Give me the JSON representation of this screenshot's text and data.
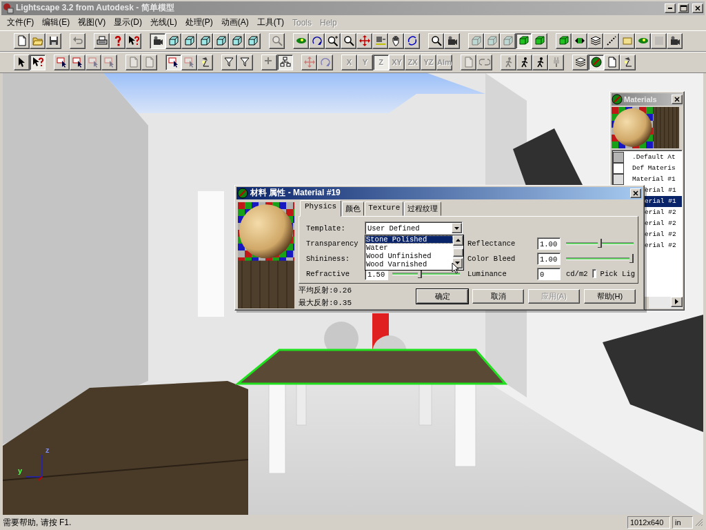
{
  "window": {
    "title": "Lightscape 3.2 from Autodesk - 简单模型"
  },
  "menu": [
    {
      "label": "文件(F)",
      "disabled": false
    },
    {
      "label": "编辑(E)",
      "disabled": false
    },
    {
      "label": "视图(V)",
      "disabled": false
    },
    {
      "label": "显示(D)",
      "disabled": false
    },
    {
      "label": "光线(L)",
      "disabled": false
    },
    {
      "label": "处理(P)",
      "disabled": false
    },
    {
      "label": "动画(A)",
      "disabled": false
    },
    {
      "label": "工具(T)",
      "disabled": false
    },
    {
      "label": "Tools",
      "disabled": true
    },
    {
      "label": "Help",
      "disabled": true
    }
  ],
  "toolbars": [
    [
      [
        {
          "pressed": false,
          "disabled": false
        },
        {
          "pressed": false,
          "disabled": false
        },
        {
          "pressed": false,
          "disabled": false
        }
      ],
      [
        {
          "pressed": false,
          "disabled": true
        }
      ],
      [
        {
          "pressed": false,
          "disabled": false
        },
        {
          "pressed": false,
          "disabled": false
        },
        {
          "pressed": false,
          "disabled": false
        }
      ],
      [
        {
          "pressed": true,
          "disabled": false
        },
        {
          "pressed": false,
          "disabled": false
        },
        {
          "pressed": false,
          "disabled": false
        },
        {
          "pressed": false,
          "disabled": false
        },
        {
          "pressed": false,
          "disabled": false
        },
        {
          "pressed": false,
          "disabled": false
        },
        {
          "pressed": false,
          "disabled": false
        }
      ],
      [
        {
          "pressed": false,
          "disabled": true
        }
      ],
      [
        {
          "pressed": false,
          "disabled": false
        },
        {
          "pressed": false,
          "disabled": false
        },
        {
          "pressed": false,
          "disabled": false
        },
        {
          "pressed": false,
          "disabled": false
        },
        {
          "pressed": false,
          "disabled": false
        },
        {
          "pressed": false,
          "disabled": false
        },
        {
          "pressed": false,
          "disabled": false
        },
        {
          "pressed": false,
          "disabled": false
        }
      ],
      [
        {
          "pressed": false,
          "disabled": false
        },
        {
          "pressed": false,
          "disabled": false
        }
      ],
      [
        {
          "pressed": false,
          "disabled": true
        },
        {
          "pressed": false,
          "disabled": true
        },
        {
          "pressed": false,
          "disabled": true
        },
        {
          "pressed": true,
          "disabled": false
        },
        {
          "pressed": false,
          "disabled": false
        }
      ],
      [
        {
          "pressed": false,
          "disabled": false
        },
        {
          "pressed": false,
          "disabled": false
        },
        {
          "pressed": false,
          "disabled": false
        },
        {
          "pressed": false,
          "disabled": false
        },
        {
          "pressed": false,
          "disabled": false
        },
        {
          "pressed": false,
          "disabled": false
        },
        {
          "pressed": false,
          "disabled": true
        },
        {
          "pressed": false,
          "disabled": false
        }
      ]
    ],
    [
      [
        {
          "pressed": false,
          "disabled": false
        },
        {
          "pressed": true,
          "disabled": false
        }
      ],
      [
        {
          "pressed": false,
          "disabled": false
        },
        {
          "pressed": false,
          "disabled": false
        },
        {
          "pressed": false,
          "disabled": true
        },
        {
          "pressed": false,
          "disabled": true
        }
      ],
      [
        {
          "pressed": false,
          "disabled": true
        },
        {
          "pressed": false,
          "disabled": true
        }
      ],
      [
        {
          "pressed": true,
          "disabled": false
        },
        {
          "pressed": false,
          "disabled": true
        },
        {
          "pressed": false,
          "disabled": false
        }
      ],
      [
        {
          "pressed": false,
          "disabled": false
        },
        {
          "pressed": false,
          "disabled": false
        }
      ],
      [
        {
          "pressed": false,
          "disabled": true
        },
        {
          "pressed": true,
          "disabled": false
        }
      ],
      [
        {
          "pressed": false,
          "disabled": true
        },
        {
          "pressed": false,
          "disabled": true
        }
      ],
      [
        {
          "label": "X",
          "pressed": false,
          "disabled": true
        },
        {
          "label": "Y",
          "pressed": false,
          "disabled": true
        },
        {
          "label": "Z",
          "pressed": true,
          "disabled": true
        },
        {
          "label": "XY",
          "pressed": false,
          "disabled": true
        },
        {
          "label": "ZX",
          "pressed": false,
          "disabled": true
        },
        {
          "label": "YZ",
          "pressed": false,
          "disabled": true
        },
        {
          "label": "Alm",
          "pressed": false,
          "disabled": true
        }
      ],
      [
        {
          "pressed": false,
          "disabled": true
        },
        {
          "pressed": false,
          "disabled": true
        }
      ],
      [
        {
          "pressed": false,
          "disabled": true
        },
        {
          "pressed": false,
          "disabled": false
        },
        {
          "pressed": false,
          "disabled": false
        },
        {
          "pressed": false,
          "disabled": true
        }
      ],
      [
        {
          "pressed": false,
          "disabled": false
        },
        {
          "pressed": true,
          "disabled": false
        },
        {
          "pressed": false,
          "disabled": false
        },
        {
          "pressed": false,
          "disabled": false
        }
      ]
    ]
  ],
  "viewport": {
    "axis_labels": [
      "z",
      "y"
    ]
  },
  "materials_panel": {
    "title": "Materials",
    "items": [
      {
        "name": ".Default At",
        "kind": "full",
        "color": "#b4b4b4",
        "selected": false
      },
      {
        "name": "Def Materis",
        "kind": "full",
        "color": "#ffffff",
        "selected": false
      },
      {
        "name": "Material #1",
        "kind": "full",
        "color": "#dcdcdc",
        "selected": false
      },
      {
        "name": "erial #1",
        "kind": "covered",
        "selected": false
      },
      {
        "name": "erial #1",
        "kind": "covered",
        "selected": true
      },
      {
        "name": "erial #2",
        "kind": "covered",
        "selected": false
      },
      {
        "name": "erial #2",
        "kind": "covered",
        "selected": false
      },
      {
        "name": "erial #2",
        "kind": "covered",
        "selected": false
      },
      {
        "name": "erial #2",
        "kind": "covered",
        "selected": false
      }
    ]
  },
  "dialog": {
    "title": "材料 属性 - Material #19",
    "tabs": [
      {
        "label": "Physics",
        "selected": true
      },
      {
        "label": "颜色",
        "selected": false
      },
      {
        "label": "Texture",
        "selected": false
      },
      {
        "label": "过程纹理",
        "selected": false
      }
    ],
    "template": {
      "label": "Template:",
      "value": "User Defined",
      "options": [
        {
          "label": "Stone Polished",
          "selected": true
        },
        {
          "label": "Water",
          "selected": false
        },
        {
          "label": "Wood Unfinished",
          "selected": false
        },
        {
          "label": "Wood Varnished",
          "selected": false
        }
      ]
    },
    "left_fields": [
      {
        "label": "Transparency",
        "kind": "covered"
      },
      {
        "label": "Shininess:",
        "kind": "covered"
      },
      {
        "label": "Refractive",
        "kind": "slider",
        "value": "1.50",
        "level": 0.4
      }
    ],
    "right_fields": [
      {
        "label": "Reflectance",
        "kind": "slider",
        "value": "1.00",
        "level": 0.5
      },
      {
        "label": "Color Bleed",
        "kind": "slider",
        "value": "1.00",
        "level": 1
      },
      {
        "label": "Luminance",
        "kind": "unit",
        "value": "0",
        "unit": "cd/m2"
      }
    ],
    "pick_light": {
      "label": "Pick Lig",
      "checked": false
    },
    "stats": [
      "平均反射:0.26",
      "最大反射:0.35"
    ],
    "buttons": [
      {
        "label": "确定",
        "default": true,
        "disabled": false
      },
      {
        "label": "取消",
        "default": false,
        "disabled": false
      },
      {
        "label": "应用(A)",
        "default": false,
        "disabled": true
      },
      {
        "label": "帮助(H)",
        "default": false,
        "disabled": false
      }
    ]
  },
  "status_bar": {
    "message": "需要帮助, 请按 F1.",
    "resolution": "1012x640",
    "units": "in"
  }
}
